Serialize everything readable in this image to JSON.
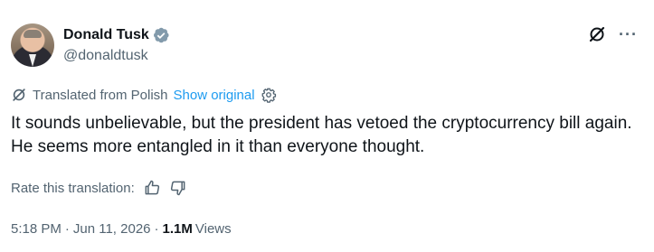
{
  "author": {
    "display_name": "Donald Tusk",
    "handle": "@donaldtusk",
    "verified_icon": "verified-badge-icon",
    "verified_color": "#829aab"
  },
  "actions": {
    "grok_icon": "grok-icon",
    "more_label": "···"
  },
  "translation": {
    "notice": "Translated from Polish",
    "show_original": "Show original",
    "settings_icon": "gear-icon"
  },
  "tweet": {
    "text": "It sounds unbelievable, but the president has vetoed the cryptocurrency bill again. He seems more entangled in it than everyone thought."
  },
  "rating": {
    "label": "Rate this translation:",
    "thumbs_up_icon": "thumbs-up-icon",
    "thumbs_down_icon": "thumbs-down-icon"
  },
  "meta": {
    "time": "5:18 PM",
    "date": "Jun 11, 2026",
    "separator": "·",
    "views_count": "1.1M",
    "views_label": "Views"
  },
  "colors": {
    "text_primary": "#0f1419",
    "text_secondary": "#536471",
    "link": "#1d9bf0"
  }
}
